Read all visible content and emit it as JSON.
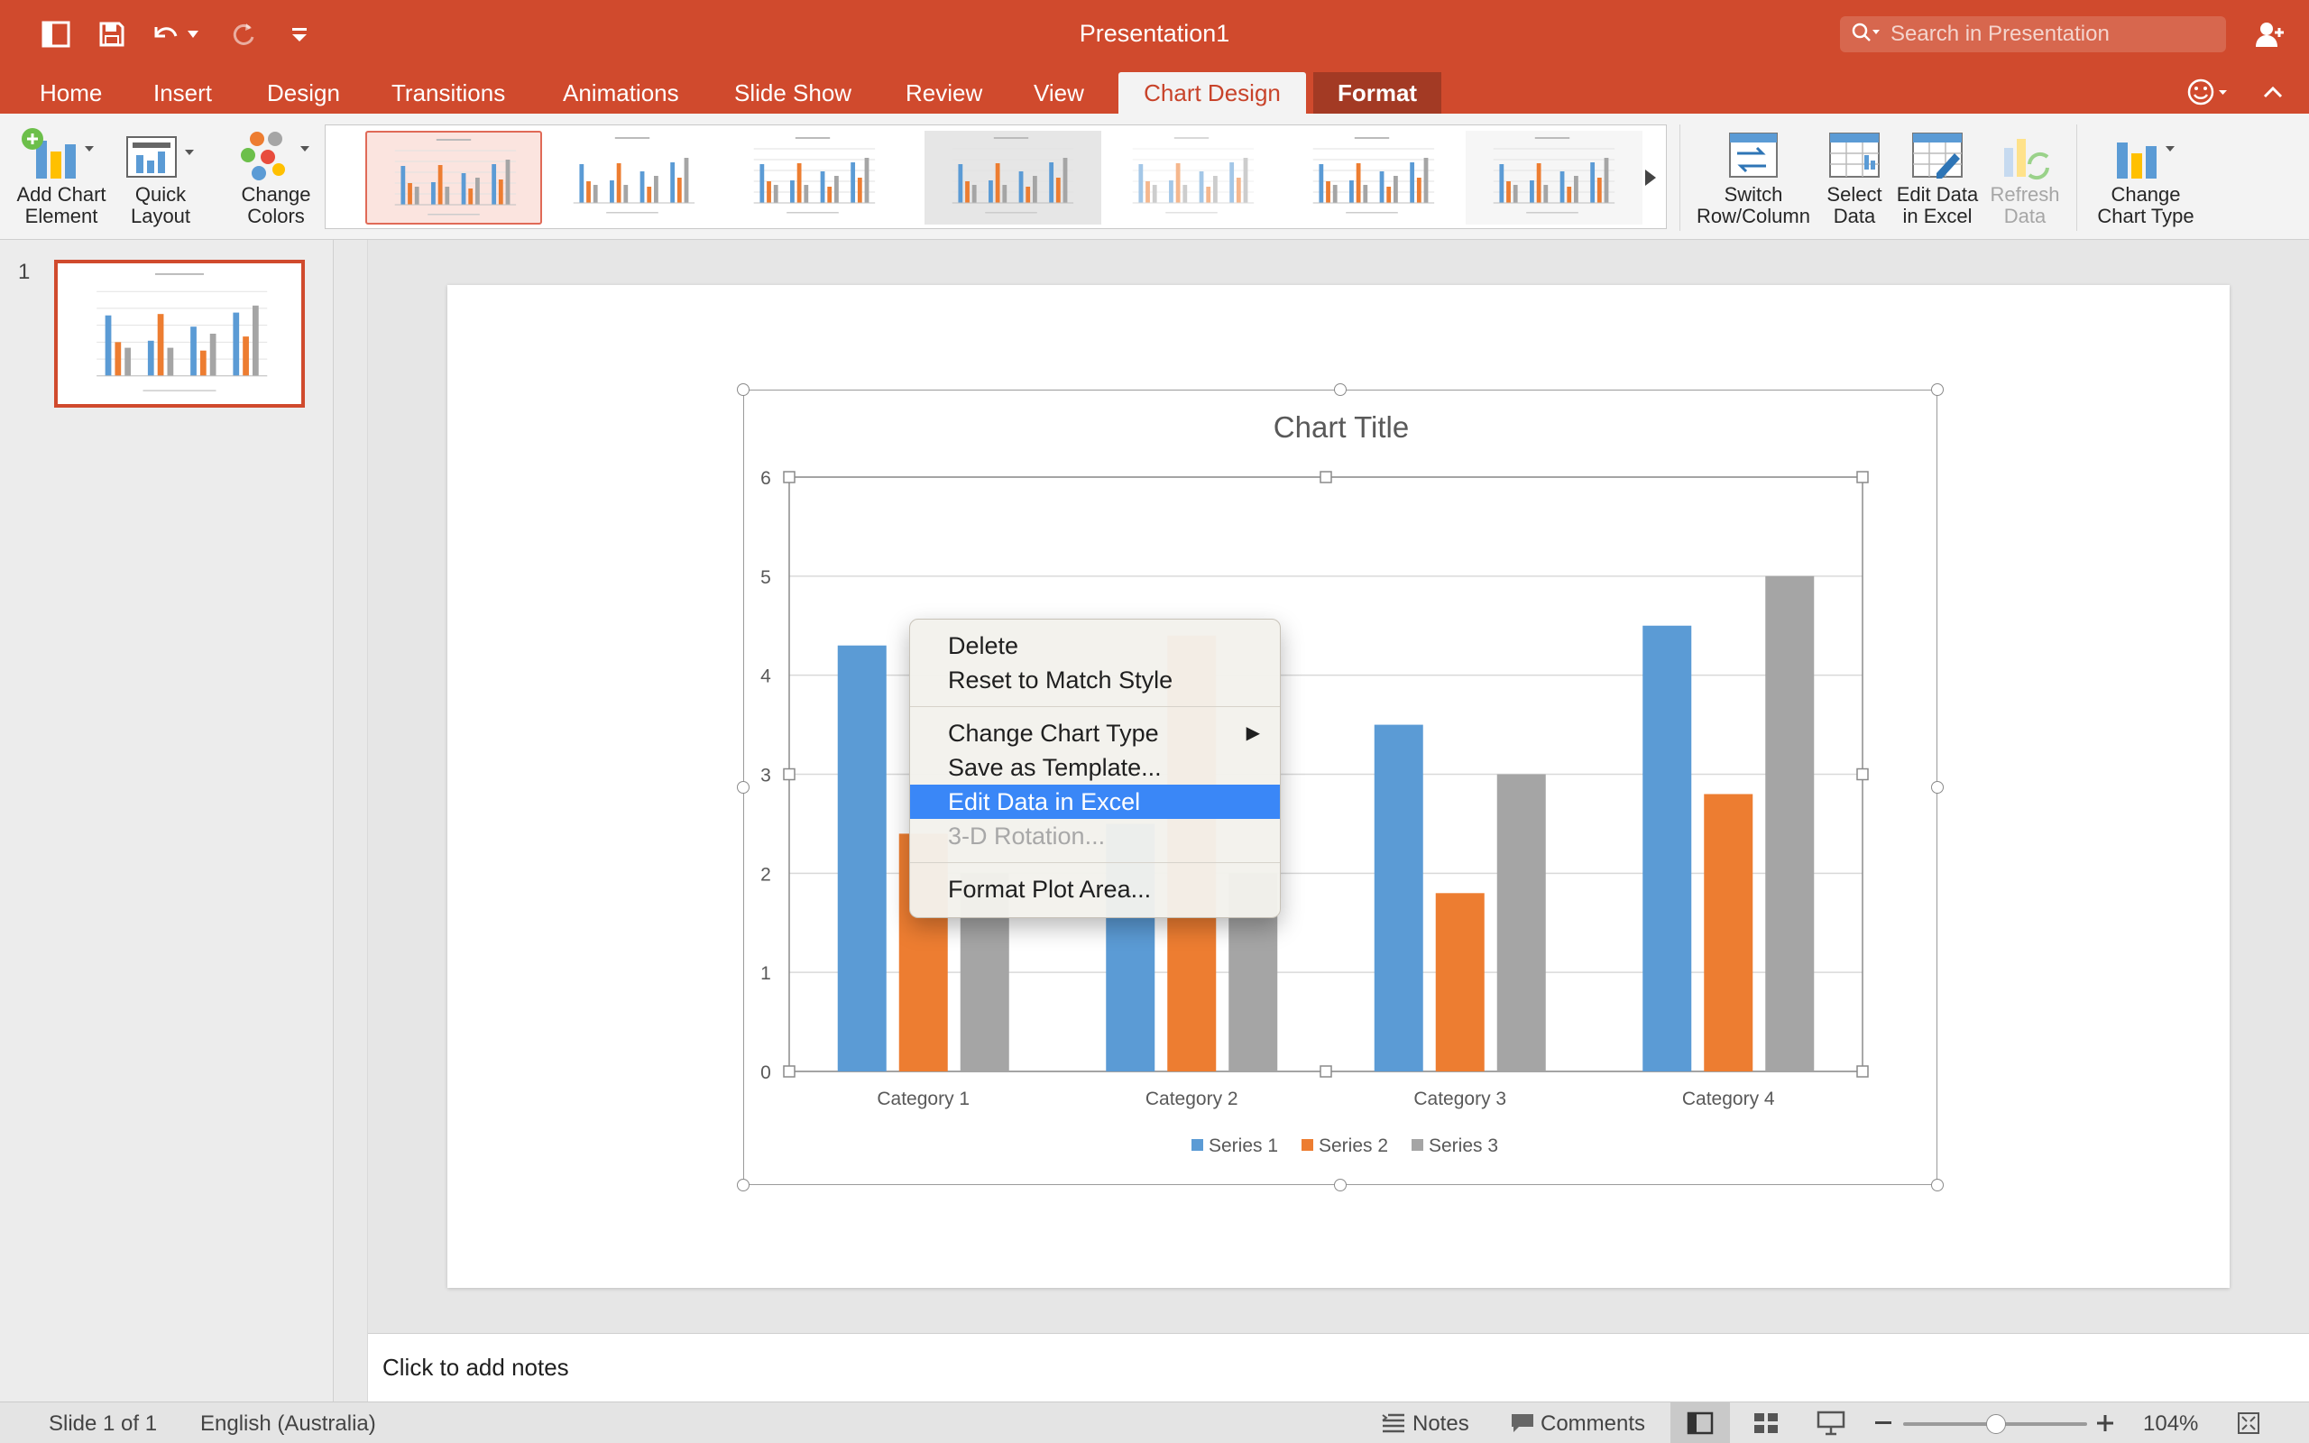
{
  "window": {
    "title": "Presentation1"
  },
  "search": {
    "placeholder": "Search in Presentation"
  },
  "tabs": [
    {
      "label": "Home"
    },
    {
      "label": "Insert"
    },
    {
      "label": "Design"
    },
    {
      "label": "Transitions"
    },
    {
      "label": "Animations"
    },
    {
      "label": "Slide Show"
    },
    {
      "label": "Review"
    },
    {
      "label": "View"
    },
    {
      "label": "Chart Design"
    },
    {
      "label": "Format"
    }
  ],
  "active_tab": "Chart Design",
  "ribbon": {
    "add_chart_element": "Add Chart\nElement",
    "quick_layout": "Quick\nLayout",
    "change_colors": "Change\nColors",
    "switch_row_column": "Switch\nRow/Column",
    "select_data": "Select\nData",
    "edit_data_in_excel": "Edit Data\nin Excel",
    "refresh_data": "Refresh\nData",
    "change_chart_type": "Change\nChart Type"
  },
  "slides_pane": {
    "slide_number": "1"
  },
  "context_menu": {
    "items": [
      {
        "label": "Delete",
        "state": "normal"
      },
      {
        "label": "Reset to Match Style",
        "state": "normal"
      },
      {
        "label": "Change Chart Type",
        "state": "normal",
        "submenu": true
      },
      {
        "label": "Save as Template...",
        "state": "normal"
      },
      {
        "label": "Edit Data in Excel",
        "state": "highlighted"
      },
      {
        "label": "3-D Rotation...",
        "state": "disabled"
      },
      {
        "label": "Format Plot Area...",
        "state": "normal"
      }
    ]
  },
  "notes": {
    "placeholder": "Click to add notes"
  },
  "status": {
    "slide": "Slide 1 of 1",
    "language": "English (Australia)",
    "notes_label": "Notes",
    "comments_label": "Comments",
    "zoom": "104%",
    "zoom_fraction": 0.52
  },
  "colors": {
    "accent": "#d04a2d",
    "series1": "#5b9bd5",
    "series2": "#ed7d31",
    "series3": "#a5a5a5",
    "menu_highlight": "#3a87f7"
  },
  "chart_data": {
    "type": "bar",
    "title": "Chart Title",
    "categories": [
      "Category 1",
      "Category 2",
      "Category 3",
      "Category 4"
    ],
    "series": [
      {
        "name": "Series 1",
        "values": [
          4.3,
          2.5,
          3.5,
          4.5
        ]
      },
      {
        "name": "Series 2",
        "values": [
          2.4,
          4.4,
          1.8,
          2.8
        ]
      },
      {
        "name": "Series 3",
        "values": [
          2,
          2,
          3,
          5
        ]
      }
    ],
    "ylim": [
      0,
      6
    ],
    "yticks": [
      "0",
      "1",
      "2",
      "3",
      "4",
      "5",
      "6"
    ],
    "grid": true,
    "legend": "bottom"
  }
}
